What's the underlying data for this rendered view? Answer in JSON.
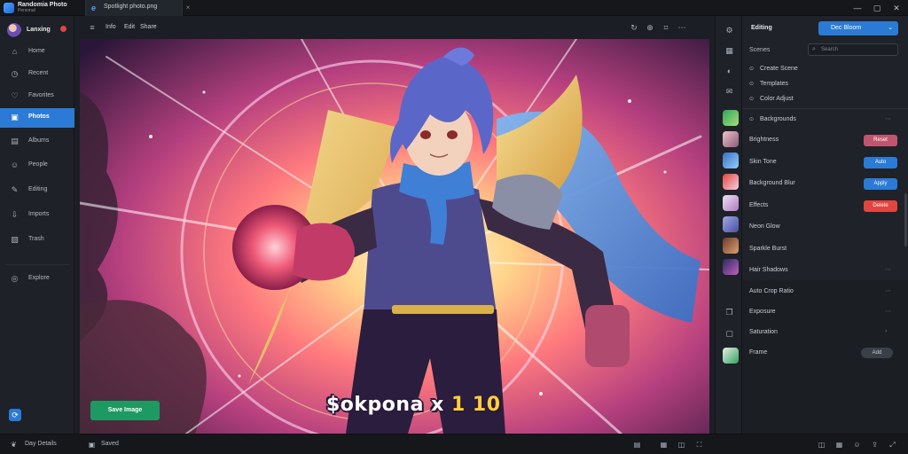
{
  "titlebar": {
    "app_title": "Randomia Photo",
    "app_subtitle": "Personal",
    "tab_label": "Spotlight photo.png",
    "tab_close": "×",
    "window_minimize": "—",
    "window_restore": "▢",
    "window_close": "✕"
  },
  "sidebar": {
    "profile_name": "Lanxing",
    "items": [
      {
        "label": "Home",
        "icon": "home-icon",
        "glyph": "⌂"
      },
      {
        "label": "Recent",
        "icon": "clock-icon",
        "glyph": "◷"
      },
      {
        "label": "Favorites",
        "icon": "heart-icon",
        "glyph": "♡"
      },
      {
        "label": "Photos",
        "icon": "photo-icon",
        "glyph": "▣"
      },
      {
        "label": "Albums",
        "icon": "album-icon",
        "glyph": "▤"
      },
      {
        "label": "People",
        "icon": "people-icon",
        "glyph": "☺"
      },
      {
        "label": "Editing",
        "icon": "brush-icon",
        "glyph": "✎"
      },
      {
        "label": "Imports",
        "icon": "import-icon",
        "glyph": "⇩"
      },
      {
        "label": "Trash",
        "icon": "trash-icon",
        "glyph": "▨"
      },
      {
        "label": "Explore",
        "icon": "explore-icon",
        "glyph": "◎"
      }
    ],
    "active_index": 3
  },
  "viewer_toolbar": {
    "menu_items": [
      "Info",
      "Edit",
      "Share"
    ],
    "right_icons": [
      "rotate-icon",
      "zoom-icon",
      "crop-icon",
      "more-icon"
    ]
  },
  "canvas": {
    "caption_main": "$okpona x ",
    "caption_accent": "1 10",
    "save_button": "Save Image"
  },
  "statusbar": {
    "left_text": "Day  Details",
    "save_label": "Saved"
  },
  "right_panel": {
    "title": "Editing",
    "dropdown_value": "Dec Bloom",
    "search_label": "Scenes",
    "search_placeholder": "Search",
    "options": [
      "Create Scene",
      "Templates",
      "Color  Adjust"
    ],
    "section_label": "Backgrounds",
    "rows": [
      {
        "label": "Brightness",
        "tag": "Reset",
        "tag_color": "#c0566e"
      },
      {
        "label": "Skin Tone",
        "tag": "Auto",
        "tag_color": "#2b7ad6"
      },
      {
        "label": "Background Blur",
        "tag": "Apply",
        "tag_color": "#2b7ad6"
      },
      {
        "label": "Effects",
        "tag": "Delete",
        "tag_color": "#e2453f"
      },
      {
        "label": "Neon Glow",
        "tag": "",
        "tag_color": ""
      },
      {
        "label": "Sparkle Burst",
        "tag": "",
        "tag_color": ""
      },
      {
        "label": "Hair Shadows",
        "tag": "",
        "tag_color": ""
      }
    ],
    "lower": [
      {
        "label": "Auto Crop Ratio"
      },
      {
        "label": "Exposure"
      },
      {
        "label": "Saturation"
      },
      {
        "label": "Frame",
        "button": "Add"
      }
    ]
  },
  "colors": {
    "accent": "#2b7ad6",
    "save_green": "#1d9a62",
    "danger": "#e2453f"
  }
}
